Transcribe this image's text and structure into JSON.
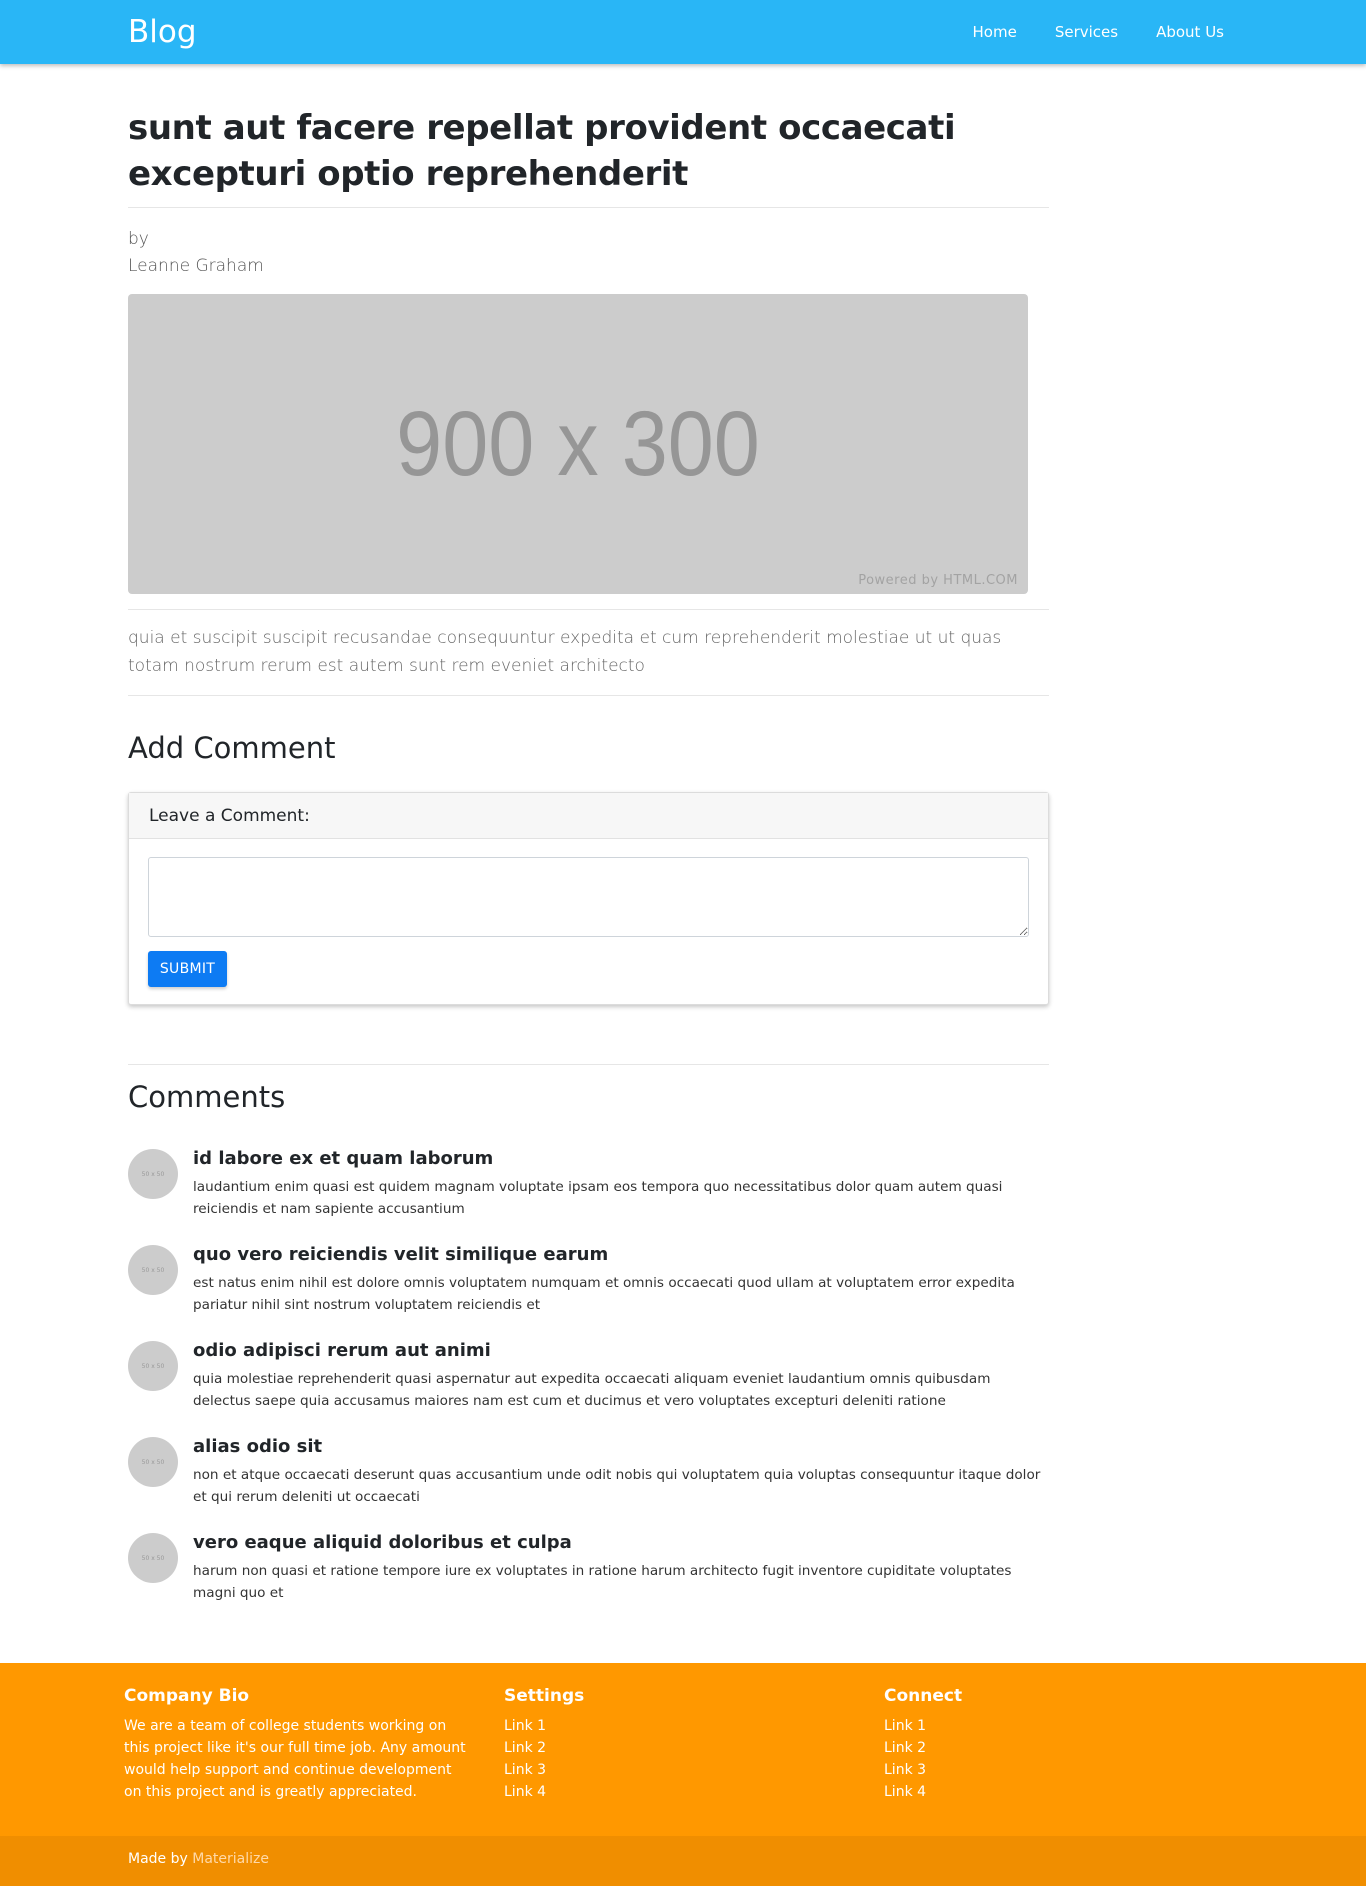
{
  "nav": {
    "brand": "Blog",
    "links": [
      "Home",
      "Services",
      "About Us"
    ]
  },
  "post": {
    "title": "sunt aut facere repellat provident occaecati excepturi optio reprehenderit",
    "by_label": "by",
    "author": "Leanne Graham",
    "image": {
      "placeholder_text": "900 x 300",
      "powered_by": "Powered by HTML.COM"
    },
    "body": "quia et suscipit suscipit recusandae consequuntur expedita et cum reprehenderit molestiae ut ut quas totam nostrum rerum est autem sunt rem eveniet architecto"
  },
  "add_comment": {
    "heading": "Add Comment",
    "card_header": "Leave a Comment:",
    "textarea_value": "",
    "submit_label": "SUBMIT"
  },
  "comments": {
    "heading": "Comments",
    "avatar_text": "50 x 50",
    "items": [
      {
        "title": "id labore ex et quam laborum",
        "body": "laudantium enim quasi est quidem magnam voluptate ipsam eos tempora quo necessitatibus dolor quam autem quasi reiciendis et nam sapiente accusantium"
      },
      {
        "title": "quo vero reiciendis velit similique earum",
        "body": "est natus enim nihil est dolore omnis voluptatem numquam et omnis occaecati quod ullam at voluptatem error expedita pariatur nihil sint nostrum voluptatem reiciendis et"
      },
      {
        "title": "odio adipisci rerum aut animi",
        "body": "quia molestiae reprehenderit quasi aspernatur aut expedita occaecati aliquam eveniet laudantium omnis quibusdam delectus saepe quia accusamus maiores nam est cum et ducimus et vero voluptates excepturi deleniti ratione"
      },
      {
        "title": "alias odio sit",
        "body": "non et atque occaecati deserunt quas accusantium unde odit nobis qui voluptatem quia voluptas consequuntur itaque dolor et qui rerum deleniti ut occaecati"
      },
      {
        "title": "vero eaque aliquid doloribus et culpa",
        "body": "harum non quasi et ratione tempore iure ex voluptates in ratione harum architecto fugit inventore cupiditate voluptates magni quo et"
      }
    ]
  },
  "footer": {
    "bio": {
      "heading": "Company Bio",
      "text": "We are a team of college students working on this project like it's our full time job. Any amount would help support and continue development on this project and is greatly appreciated."
    },
    "settings": {
      "heading": "Settings",
      "links": [
        "Link 1",
        "Link 2",
        "Link 3",
        "Link 4"
      ]
    },
    "connect": {
      "heading": "Connect",
      "links": [
        "Link 1",
        "Link 2",
        "Link 3",
        "Link 4"
      ]
    },
    "made_by_prefix": "Made by",
    "made_by_link": "Materialize"
  },
  "colors": {
    "navbar": "#29b6f6",
    "footer": "#ff9800",
    "footer_copyright": "#f08e00",
    "submit_button": "#0d7bf3",
    "image_placeholder": "#cccccc"
  }
}
